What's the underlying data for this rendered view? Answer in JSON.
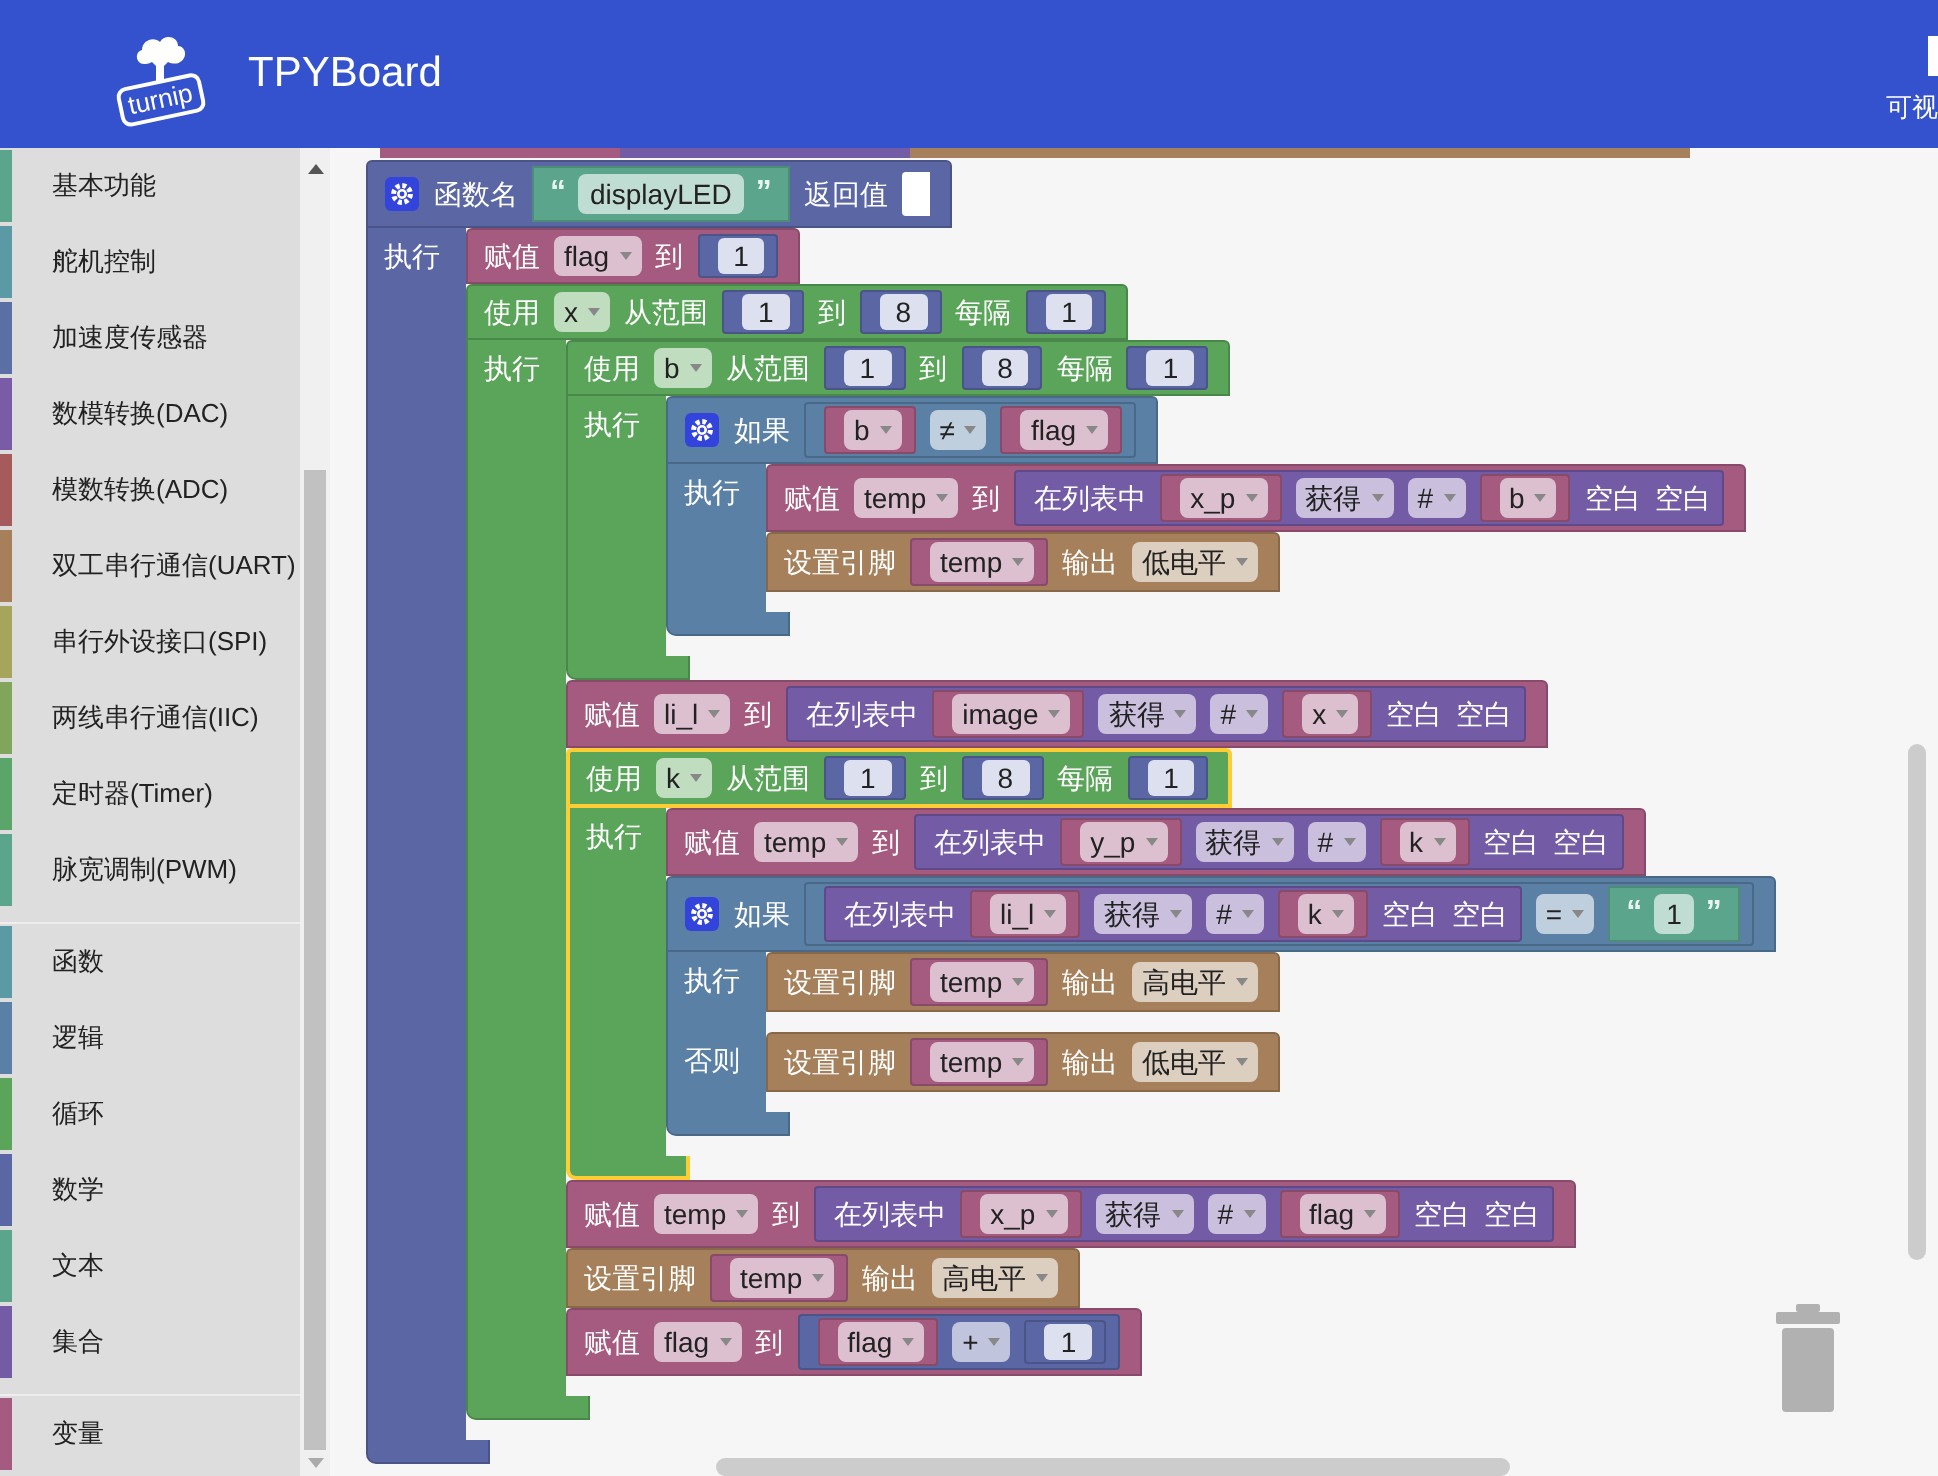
{
  "header": {
    "logo_text": "turnip",
    "title": "TPYBoard",
    "right_label": "可视"
  },
  "toolbox": {
    "groups": [
      {
        "items": [
          {
            "label": "基本功能",
            "color": "#5ba58c"
          },
          {
            "label": "舵机控制",
            "color": "#5b9aa5"
          },
          {
            "label": "加速度传感器",
            "color": "#5b6fa5"
          },
          {
            "label": "数模转换(DAC)",
            "color": "#7a5ba5"
          },
          {
            "label": "模数转换(ADC)",
            "color": "#a55b5b"
          },
          {
            "label": "双工串行通信(UART)",
            "color": "#a5805b"
          },
          {
            "label": "串行外设接口(SPI)",
            "color": "#a5a55b"
          },
          {
            "label": "两线串行通信(IIC)",
            "color": "#80a55b"
          },
          {
            "label": "定时器(Timer)",
            "color": "#5ba56b"
          },
          {
            "label": "脉宽调制(PWM)",
            "color": "#5ba58c"
          }
        ]
      },
      {
        "items": [
          {
            "label": "函数",
            "color": "#5b99a5"
          },
          {
            "label": "逻辑",
            "color": "#5b80a5"
          },
          {
            "label": "循环",
            "color": "#5ba55b"
          },
          {
            "label": "数学",
            "color": "#5b67a5"
          },
          {
            "label": "文本",
            "color": "#5ba58c"
          },
          {
            "label": "集合",
            "color": "#745ba5"
          }
        ]
      },
      {
        "items": [
          {
            "label": "变量",
            "color": "#a55b80"
          }
        ]
      }
    ]
  },
  "workspace": {
    "partial_blocks": [
      {
        "color": "#a55b80"
      },
      {
        "color": "#745ba5"
      },
      {
        "color": "#a5805b"
      }
    ],
    "blocks": [
      {
        "kind": "statement",
        "color": "#5b67a5",
        "selected": false,
        "mutator": true,
        "tokens": [
          {
            "kind": "label",
            "text": "函数名"
          },
          {
            "kind": "string",
            "color": "#5ba58c",
            "open": "“",
            "text": "displayLED",
            "close": "”"
          },
          {
            "kind": "label",
            "text": "返回值"
          },
          {
            "kind": "socket"
          }
        ],
        "sections": [
          {
            "label": "执行",
            "body": [
              {
                "kind": "statement",
                "color": "#a55b80",
                "selected": false,
                "tokens": [
                  {
                    "kind": "label",
                    "text": "赋值"
                  },
                  {
                    "kind": "dropdown",
                    "text": "flag"
                  },
                  {
                    "kind": "label",
                    "text": "到"
                  },
                  {
                    "kind": "value",
                    "color": "#5b67a5",
                    "tokens": [
                      {
                        "kind": "number",
                        "text": "1"
                      }
                    ]
                  }
                ]
              },
              {
                "kind": "statement",
                "color": "#5ba55b",
                "selected": false,
                "tokens": [
                  {
                    "kind": "label",
                    "text": "使用"
                  },
                  {
                    "kind": "dropdown",
                    "text": "x"
                  },
                  {
                    "kind": "label",
                    "text": "从范围"
                  },
                  {
                    "kind": "value",
                    "color": "#5b67a5",
                    "tokens": [
                      {
                        "kind": "number",
                        "text": "1"
                      }
                    ]
                  },
                  {
                    "kind": "label",
                    "text": "到"
                  },
                  {
                    "kind": "value",
                    "color": "#5b67a5",
                    "tokens": [
                      {
                        "kind": "number",
                        "text": "8"
                      }
                    ]
                  },
                  {
                    "kind": "label",
                    "text": "每隔"
                  },
                  {
                    "kind": "value",
                    "color": "#5b67a5",
                    "tokens": [
                      {
                        "kind": "number",
                        "text": "1"
                      }
                    ]
                  }
                ],
                "sections": [
                  {
                    "label": "执行",
                    "body": [
                      {
                        "kind": "statement",
                        "color": "#5ba55b",
                        "selected": false,
                        "tokens": [
                          {
                            "kind": "label",
                            "text": "使用"
                          },
                          {
                            "kind": "dropdown",
                            "text": "b"
                          },
                          {
                            "kind": "label",
                            "text": "从范围"
                          },
                          {
                            "kind": "value",
                            "color": "#5b67a5",
                            "tokens": [
                              {
                                "kind": "number",
                                "text": "1"
                              }
                            ]
                          },
                          {
                            "kind": "label",
                            "text": "到"
                          },
                          {
                            "kind": "value",
                            "color": "#5b67a5",
                            "tokens": [
                              {
                                "kind": "number",
                                "text": "8"
                              }
                            ]
                          },
                          {
                            "kind": "label",
                            "text": "每隔"
                          },
                          {
                            "kind": "value",
                            "color": "#5b67a5",
                            "tokens": [
                              {
                                "kind": "number",
                                "text": "1"
                              }
                            ]
                          }
                        ],
                        "sections": [
                          {
                            "label": "执行",
                            "body": [
                              {
                                "kind": "statement",
                                "color": "#5b80a5",
                                "selected": false,
                                "mutator": true,
                                "tokens": [
                                  {
                                    "kind": "label",
                                    "text": "如果"
                                  },
                                  {
                                    "kind": "value",
                                    "color": "#5b80a5",
                                    "tokens": [
                                      {
                                        "kind": "value",
                                        "color": "#a55b80",
                                        "tokens": [
                                          {
                                            "kind": "dropdown",
                                            "text": "b"
                                          }
                                        ]
                                      },
                                      {
                                        "kind": "dropdown",
                                        "text": "≠"
                                      },
                                      {
                                        "kind": "value",
                                        "color": "#a55b80",
                                        "tokens": [
                                          {
                                            "kind": "dropdown",
                                            "text": "flag"
                                          }
                                        ]
                                      }
                                    ]
                                  }
                                ],
                                "sections": [
                                  {
                                    "label": "执行",
                                    "body": [
                                      {
                                        "kind": "statement",
                                        "color": "#a55b80",
                                        "selected": false,
                                        "tokens": [
                                          {
                                            "kind": "label",
                                            "text": "赋值"
                                          },
                                          {
                                            "kind": "dropdown",
                                            "text": "temp"
                                          },
                                          {
                                            "kind": "label",
                                            "text": "到"
                                          },
                                          {
                                            "kind": "value",
                                            "color": "#745ba5",
                                            "tokens": [
                                              {
                                                "kind": "label",
                                                "text": "在列表中"
                                              },
                                              {
                                                "kind": "value",
                                                "color": "#a55b80",
                                                "tokens": [
                                                  {
                                                    "kind": "dropdown",
                                                    "text": "x_p"
                                                  }
                                                ]
                                              },
                                              {
                                                "kind": "dropdown",
                                                "text": "获得"
                                              },
                                              {
                                                "kind": "dropdown",
                                                "text": "#"
                                              },
                                              {
                                                "kind": "value",
                                                "color": "#a55b80",
                                                "tokens": [
                                                  {
                                                    "kind": "dropdown",
                                                    "text": "b"
                                                  }
                                                ]
                                              },
                                              {
                                                "kind": "label",
                                                "text": "空白"
                                              },
                                              {
                                                "kind": "label",
                                                "text": "空白"
                                              }
                                            ]
                                          }
                                        ]
                                      },
                                      {
                                        "kind": "statement",
                                        "color": "#a5805b",
                                        "selected": false,
                                        "tokens": [
                                          {
                                            "kind": "label",
                                            "text": "设置引脚"
                                          },
                                          {
                                            "kind": "value",
                                            "color": "#a55b80",
                                            "tokens": [
                                              {
                                                "kind": "dropdown",
                                                "text": "temp"
                                              }
                                            ]
                                          },
                                          {
                                            "kind": "label",
                                            "text": "输出"
                                          },
                                          {
                                            "kind": "dropdown",
                                            "text": "低电平"
                                          }
                                        ]
                                      }
                                    ]
                                  }
                                ]
                              }
                            ]
                          }
                        ]
                      },
                      {
                        "kind": "statement",
                        "color": "#a55b80",
                        "selected": false,
                        "tokens": [
                          {
                            "kind": "label",
                            "text": "赋值"
                          },
                          {
                            "kind": "dropdown",
                            "text": "li_l"
                          },
                          {
                            "kind": "label",
                            "text": "到"
                          },
                          {
                            "kind": "value",
                            "color": "#745ba5",
                            "tokens": [
                              {
                                "kind": "label",
                                "text": "在列表中"
                              },
                              {
                                "kind": "value",
                                "color": "#a55b80",
                                "tokens": [
                                  {
                                    "kind": "dropdown",
                                    "text": "image"
                                  }
                                ]
                              },
                              {
                                "kind": "dropdown",
                                "text": "获得"
                              },
                              {
                                "kind": "dropdown",
                                "text": "#"
                              },
                              {
                                "kind": "value",
                                "color": "#a55b80",
                                "tokens": [
                                  {
                                    "kind": "dropdown",
                                    "text": "x"
                                  }
                                ]
                              },
                              {
                                "kind": "label",
                                "text": "空白"
                              },
                              {
                                "kind": "label",
                                "text": "空白"
                              }
                            ]
                          }
                        ]
                      },
                      {
                        "kind": "statement",
                        "color": "#5ba55b",
                        "selected": true,
                        "tokens": [
                          {
                            "kind": "label",
                            "text": "使用"
                          },
                          {
                            "kind": "dropdown",
                            "text": "k"
                          },
                          {
                            "kind": "label",
                            "text": "从范围"
                          },
                          {
                            "kind": "value",
                            "color": "#5b67a5",
                            "tokens": [
                              {
                                "kind": "number",
                                "text": "1"
                              }
                            ]
                          },
                          {
                            "kind": "label",
                            "text": "到"
                          },
                          {
                            "kind": "value",
                            "color": "#5b67a5",
                            "tokens": [
                              {
                                "kind": "number",
                                "text": "8"
                              }
                            ]
                          },
                          {
                            "kind": "label",
                            "text": "每隔"
                          },
                          {
                            "kind": "value",
                            "color": "#5b67a5",
                            "tokens": [
                              {
                                "kind": "number",
                                "text": "1"
                              }
                            ]
                          }
                        ],
                        "sections": [
                          {
                            "label": "执行",
                            "body": [
                              {
                                "kind": "statement",
                                "color": "#a55b80",
                                "selected": false,
                                "tokens": [
                                  {
                                    "kind": "label",
                                    "text": "赋值"
                                  },
                                  {
                                    "kind": "dropdown",
                                    "text": "temp"
                                  },
                                  {
                                    "kind": "label",
                                    "text": "到"
                                  },
                                  {
                                    "kind": "value",
                                    "color": "#745ba5",
                                    "tokens": [
                                      {
                                        "kind": "label",
                                        "text": "在列表中"
                                      },
                                      {
                                        "kind": "value",
                                        "color": "#a55b80",
                                        "tokens": [
                                          {
                                            "kind": "dropdown",
                                            "text": "y_p"
                                          }
                                        ]
                                      },
                                      {
                                        "kind": "dropdown",
                                        "text": "获得"
                                      },
                                      {
                                        "kind": "dropdown",
                                        "text": "#"
                                      },
                                      {
                                        "kind": "value",
                                        "color": "#a55b80",
                                        "tokens": [
                                          {
                                            "kind": "dropdown",
                                            "text": "k"
                                          }
                                        ]
                                      },
                                      {
                                        "kind": "label",
                                        "text": "空白"
                                      },
                                      {
                                        "kind": "label",
                                        "text": "空白"
                                      }
                                    ]
                                  }
                                ]
                              },
                              {
                                "kind": "statement",
                                "color": "#5b80a5",
                                "selected": false,
                                "mutator": true,
                                "tokens": [
                                  {
                                    "kind": "label",
                                    "text": "如果"
                                  },
                                  {
                                    "kind": "value",
                                    "color": "#5b80a5",
                                    "tokens": [
                                      {
                                        "kind": "value",
                                        "color": "#745ba5",
                                        "tokens": [
                                          {
                                            "kind": "label",
                                            "text": "在列表中"
                                          },
                                          {
                                            "kind": "value",
                                            "color": "#a55b80",
                                            "tokens": [
                                              {
                                                "kind": "dropdown",
                                                "text": "li_l"
                                              }
                                            ]
                                          },
                                          {
                                            "kind": "dropdown",
                                            "text": "获得"
                                          },
                                          {
                                            "kind": "dropdown",
                                            "text": "#"
                                          },
                                          {
                                            "kind": "value",
                                            "color": "#a55b80",
                                            "tokens": [
                                              {
                                                "kind": "dropdown",
                                                "text": "k"
                                              }
                                            ]
                                          },
                                          {
                                            "kind": "label",
                                            "text": "空白"
                                          },
                                          {
                                            "kind": "label",
                                            "text": "空白"
                                          }
                                        ]
                                      },
                                      {
                                        "kind": "dropdown",
                                        "text": "="
                                      },
                                      {
                                        "kind": "string",
                                        "color": "#5ba58c",
                                        "open": "“",
                                        "text": "1",
                                        "close": "”"
                                      }
                                    ]
                                  }
                                ],
                                "sections": [
                                  {
                                    "label": "执行",
                                    "body": [
                                      {
                                        "kind": "statement",
                                        "color": "#a5805b",
                                        "selected": false,
                                        "tokens": [
                                          {
                                            "kind": "label",
                                            "text": "设置引脚"
                                          },
                                          {
                                            "kind": "value",
                                            "color": "#a55b80",
                                            "tokens": [
                                              {
                                                "kind": "dropdown",
                                                "text": "temp"
                                              }
                                            ]
                                          },
                                          {
                                            "kind": "label",
                                            "text": "输出"
                                          },
                                          {
                                            "kind": "dropdown",
                                            "text": "高电平"
                                          }
                                        ]
                                      }
                                    ]
                                  },
                                  {
                                    "label": "否则",
                                    "body": [
                                      {
                                        "kind": "statement",
                                        "color": "#a5805b",
                                        "selected": false,
                                        "tokens": [
                                          {
                                            "kind": "label",
                                            "text": "设置引脚"
                                          },
                                          {
                                            "kind": "value",
                                            "color": "#a55b80",
                                            "tokens": [
                                              {
                                                "kind": "dropdown",
                                                "text": "temp"
                                              }
                                            ]
                                          },
                                          {
                                            "kind": "label",
                                            "text": "输出"
                                          },
                                          {
                                            "kind": "dropdown",
                                            "text": "低电平"
                                          }
                                        ]
                                      }
                                    ]
                                  }
                                ]
                              }
                            ]
                          }
                        ]
                      },
                      {
                        "kind": "statement",
                        "color": "#a55b80",
                        "selected": false,
                        "tokens": [
                          {
                            "kind": "label",
                            "text": "赋值"
                          },
                          {
                            "kind": "dropdown",
                            "text": "temp"
                          },
                          {
                            "kind": "label",
                            "text": "到"
                          },
                          {
                            "kind": "value",
                            "color": "#745ba5",
                            "tokens": [
                              {
                                "kind": "label",
                                "text": "在列表中"
                              },
                              {
                                "kind": "value",
                                "color": "#a55b80",
                                "tokens": [
                                  {
                                    "kind": "dropdown",
                                    "text": "x_p"
                                  }
                                ]
                              },
                              {
                                "kind": "dropdown",
                                "text": "获得"
                              },
                              {
                                "kind": "dropdown",
                                "text": "#"
                              },
                              {
                                "kind": "value",
                                "color": "#a55b80",
                                "tokens": [
                                  {
                                    "kind": "dropdown",
                                    "text": "flag"
                                  }
                                ]
                              },
                              {
                                "kind": "label",
                                "text": "空白"
                              },
                              {
                                "kind": "label",
                                "text": "空白"
                              }
                            ]
                          }
                        ]
                      },
                      {
                        "kind": "statement",
                        "color": "#a5805b",
                        "selected": false,
                        "tokens": [
                          {
                            "kind": "label",
                            "text": "设置引脚"
                          },
                          {
                            "kind": "value",
                            "color": "#a55b80",
                            "tokens": [
                              {
                                "kind": "dropdown",
                                "text": "temp"
                              }
                            ]
                          },
                          {
                            "kind": "label",
                            "text": "输出"
                          },
                          {
                            "kind": "dropdown",
                            "text": "高电平"
                          }
                        ]
                      },
                      {
                        "kind": "statement",
                        "color": "#a55b80",
                        "selected": false,
                        "tokens": [
                          {
                            "kind": "label",
                            "text": "赋值"
                          },
                          {
                            "kind": "dropdown",
                            "text": "flag"
                          },
                          {
                            "kind": "label",
                            "text": "到"
                          },
                          {
                            "kind": "value",
                            "color": "#5b67a5",
                            "tokens": [
                              {
                                "kind": "value",
                                "color": "#a55b80",
                                "tokens": [
                                  {
                                    "kind": "dropdown",
                                    "text": "flag"
                                  }
                                ]
                              },
                              {
                                "kind": "dropdown",
                                "text": "+"
                              },
                              {
                                "kind": "value",
                                "color": "#5b67a5",
                                "tokens": [
                                  {
                                    "kind": "number",
                                    "text": "1"
                                  }
                                ]
                              }
                            ]
                          }
                        ]
                      }
                    ]
                  }
                ]
              }
            ]
          }
        ]
      }
    ]
  }
}
